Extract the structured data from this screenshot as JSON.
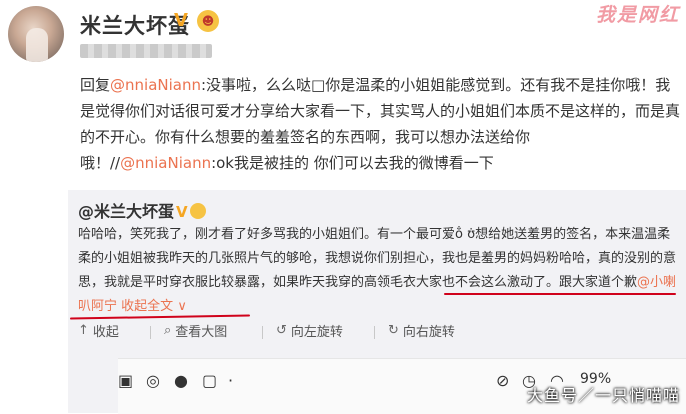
{
  "post": {
    "username": "米兰大坏蛋",
    "vbadge": "V",
    "emoji": "😈",
    "watermark": "我是网红",
    "reply_prefix": "回复",
    "reply_mention": "@nniaNiann",
    "reply_text": ":没事啦，么么哒□你是温柔的小姐姐能感觉到。还有我不是挂你哦！我是觉得你们对话很可爱才分享给大家看一下，其实骂人的小姐姐们本质不是这样的，而是真的不开心。你有什么想要的羞羞签名的东西啊，我可以想办法送给你哦！//",
    "reply_mention2": "@nniaNiann",
    "reply_text2": ":ok我是被挂的 你们可以去我的微博看一下"
  },
  "retweet": {
    "username": "@米兰大坏蛋",
    "vbadge": "V",
    "body_part1": "哈哈哈，笑死我了，刚才看了好多骂我的小姐姐们。有一个最可爱o̐ ʊ̇想给她送羞男的签名，本来温温柔柔的小姐姐被我昨天的几张照片气的够呛，我想说你们别担心，我也是羞男的妈妈粉哈哈，真的没别的意思，我就是平时穿衣服比较暴露，",
    "body_part2": "如果昨天我穿的高领毛衣大家也不会这么激动了。跟大家道个歉",
    "mention": "@小喇叭阿宁",
    "expand": "收起全文",
    "expand_arrow": "∨",
    "actions": {
      "collapse": "收起",
      "view_large": "查看大图",
      "rotate_left": "向左旋转",
      "rotate_right": "向右旋转"
    }
  },
  "statusbar": {
    "battery_text": "99%",
    "watermark": "大鱼号／一只悄喵喵"
  }
}
